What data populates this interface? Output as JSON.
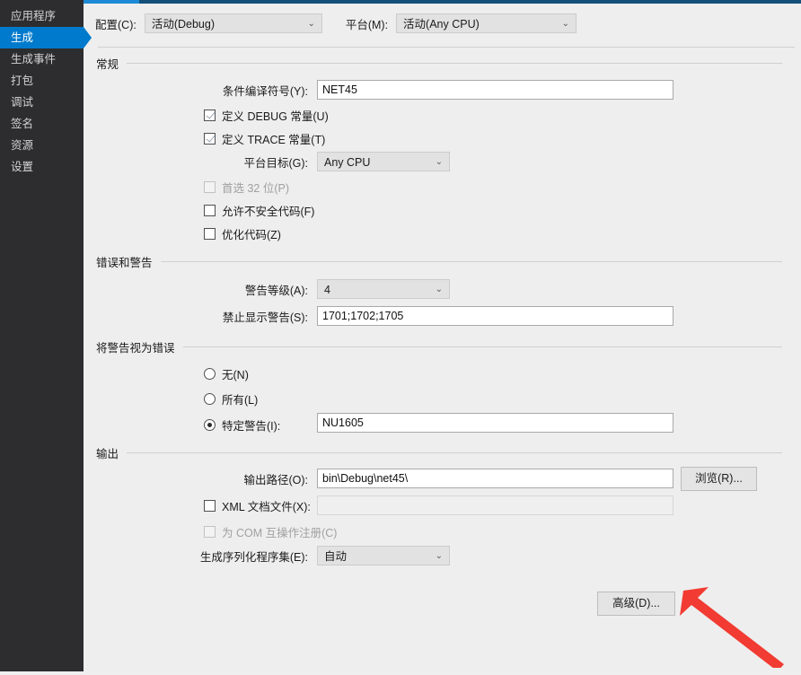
{
  "colors": {
    "sidebar_bg": "#2d2d30",
    "sidebar_selected": "#007acc",
    "top_border": "#12507a",
    "top_accent": "#1e8ad6",
    "content_bg": "#eeeeee",
    "annotation_arrow": "#f23b32"
  },
  "sidebar": {
    "items": [
      {
        "label": "应用程序",
        "selected": false
      },
      {
        "label": "生成",
        "selected": true
      },
      {
        "label": "生成事件",
        "selected": false
      },
      {
        "label": "打包",
        "selected": false
      },
      {
        "label": "调试",
        "selected": false
      },
      {
        "label": "签名",
        "selected": false
      },
      {
        "label": "资源",
        "selected": false
      },
      {
        "label": "设置",
        "selected": false
      }
    ]
  },
  "config_row": {
    "configuration_label": "配置(C):",
    "configuration_value": "活动(Debug)",
    "platform_label": "平台(M):",
    "platform_value": "活动(Any CPU)",
    "chevron": "⌄"
  },
  "general": {
    "title": "常规",
    "conditional_symbols_label": "条件编译符号(Y):",
    "conditional_symbols_value": "NET45",
    "define_debug_label": "定义 DEBUG 常量(U)",
    "define_debug_checked": true,
    "define_trace_label": "定义 TRACE 常量(T)",
    "define_trace_checked": true,
    "platform_target_label": "平台目标(G):",
    "platform_target_value": "Any CPU",
    "prefer32_label": "首选 32 位(P)",
    "prefer32_checked": false,
    "prefer32_disabled": true,
    "unsafe_label": "允许不安全代码(F)",
    "unsafe_checked": false,
    "optimize_label": "优化代码(Z)",
    "optimize_checked": false
  },
  "errors_warnings": {
    "title": "错误和警告",
    "warning_level_label": "警告等级(A):",
    "warning_level_value": "4",
    "suppress_warnings_label": "禁止显示警告(S):",
    "suppress_warnings_value": "1701;1702;1705"
  },
  "warnings_as_errors": {
    "title": "将警告视为错误",
    "none_label": "无(N)",
    "none_selected": false,
    "all_label": "所有(L)",
    "all_selected": false,
    "specific_label": "特定警告(I):",
    "specific_selected": true,
    "specific_value": "NU1605"
  },
  "output": {
    "title": "输出",
    "output_path_label": "输出路径(O):",
    "output_path_value": "bin\\Debug\\net45\\",
    "browse_label": "浏览(R)...",
    "xml_doc_label": "XML 文档文件(X):",
    "xml_doc_checked": false,
    "xml_doc_value": "",
    "com_interop_label": "为 COM 互操作注册(C)",
    "com_interop_checked": false,
    "com_interop_disabled": true,
    "serialization_label": "生成序列化程序集(E):",
    "serialization_value": "自动"
  },
  "footer": {
    "advanced_label": "高级(D)..."
  }
}
